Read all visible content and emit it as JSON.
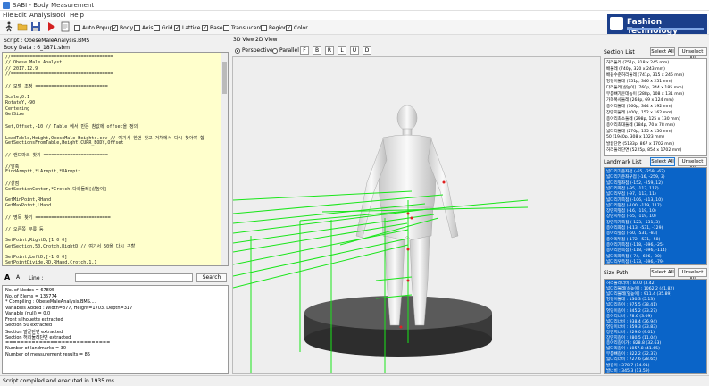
{
  "window": {
    "title": "SABI - Body Measurement"
  },
  "menu": [
    "File",
    "Edit",
    "Analysis",
    "Tool",
    "Help"
  ],
  "toolbar": {
    "buttons": [
      {
        "icon": "walk-icon"
      },
      {
        "icon": "open-folder-icon"
      },
      {
        "icon": "save-icon"
      },
      {
        "icon": "run-icon"
      },
      {
        "icon": "document-icon"
      }
    ],
    "auto_popup": "Auto Popup",
    "checkboxes": [
      {
        "label": "Body",
        "checked": true
      },
      {
        "label": "Axis",
        "checked": false
      },
      {
        "label": "Grid",
        "checked": false
      },
      {
        "label": "Lattice",
        "checked": true
      },
      {
        "label": "Base",
        "checked": true
      },
      {
        "label": "Translucent",
        "checked": false
      },
      {
        "label": "Region",
        "checked": false
      },
      {
        "label": "Color",
        "checked": true
      }
    ]
  },
  "brand": {
    "text": "Fashion Technology"
  },
  "script_info": {
    "script": "Script : ObeseMaleAnalysis.BMS",
    "body_data": "Body Data : 6_1871.sbm"
  },
  "script_lines": [
    "//======================================",
    "//          Obese Male Analyst",
    "//            2017.12.9",
    "//======================================",
    "",
    "// 모델 조정 ===========================",
    "",
    "Scale,0.1",
    "RotateY,-90",
    "Centering",
    "GetSize",
    "",
    "Set,Offset,-10        // Table 에서 만든 참값에 offset을 정의",
    "",
    "LoadTable,Height,ObeseMale_Heights.csv     // 여기서 한번 찾고 거쳐에서 다시 찾아야 함",
    "GetSectionsFromTable,Height,CURR_BODY,Offset",
    "",
    "// 랜드마크 찾기 ========================",
    "",
    "//앞축",
    "FindArmpit,*LArmpit,*RArmpit",
    "",
    "//샅점",
    "GetSectionCenter,*Crotch,다리둘레[샅높이]",
    "",
    "GetMinPoint,RHand",
    "GetMaxPoint,LHand",
    "",
    "// 명목 찾기 ============================",
    "",
    "// 오른쪽 무릎 등",
    "",
    "SetPoint,RightD,[1 0 0]",
    "GetSection,50,Crotch,RightD // 여기서 50을 다시 구할",
    "",
    "SetPoint,LeftD,[-1 0 0]",
    "SetPointDivide,RD,RHand,Crotch,1,1"
  ],
  "find": {
    "aa": "A",
    "aa2": "A",
    "line_label": "Line :",
    "search": "Search"
  },
  "console": [
    "No. of Nodes = 67895",
    "No. of Elems = 135774",
    "* Compiling : ObeseMaleAnalysis.BMS....",
    "Variables Added : Width=877, Height=1703, Depth=317",
    "Variable (null) = 0.0",
    "Front silhouette extracted",
    "Section 50 extracted",
    "Section 발끝단면 extracted",
    "Section 허리둘레단면 extracted",
    "============================",
    "Number of landmarks = 30",
    "Number of measurement results = 85"
  ],
  "status": "Script compiled and executed in 1935 ms",
  "view": {
    "tabs": [
      "3D View",
      "2D View"
    ],
    "perspective": "Perspective",
    "parallel": "Parallel",
    "buttons": [
      "F",
      "B",
      "R",
      "L",
      "U",
      "D"
    ]
  },
  "section_list": {
    "title": "Section List",
    "select_all": "Select All",
    "unselect_all": "Unselect All",
    "items": [
      "허리둘레 (751p, 318 x 245 mm)",
      "배둘레 (740p, 320 x 243 mm)",
      "배꼽수준허리둘레 (741p, 315 x 246 mm)",
      "엉덩이둘레 (751p, 346 x 251 mm)",
      "다리둘레[샅높이] (760p, 344 x 185 mm)",
      "무릎뼈가운데높이 (288p, 108 x 131 mm)",
      "가쪽복사둘레 (268p, 69 x 124 mm)",
      "종아리둘레 (760p, 344 x 192 mm)",
      "장딴지둘레 (400p, 152 x 162 mm)",
      "종아리최소둘레 (298p, 125 x 130 mm)",
      "종아리최대둘레 (184p, 70 x 78 mm)",
      "넓다리둘레 (270p, 135 x 150 mm)",
      "50 (1940p, 308 x 1023 mm)",
      "발끝단면 (5183p, 867 x 1702 mm)",
      "허리둘레단면 (5225p, 854 x 1702 mm)"
    ]
  },
  "landmark_list": {
    "title": "Landmark List",
    "select_all": "Select All",
    "unselect_all": "Unselect All",
    "items": [
      "넓다리기준좌점 (-65, -259, -62)",
      "넓다리기준좌우점 (-16, -259, 3)",
      "넓다리앞좌점 (-152, -259, 12)",
      "넓다리좌점 (-95, -113, 117)",
      "넓다리우점 (-97, -113, 11)",
      "넓다리가쪽점 (-106, -113, 10)",
      "넓다리앞점 (-100, -119, 117)",
      "장딴지앞점 (-16, -119, 10)",
      "장딴지뒤점 (-65, -119, 10)",
      "장딴지가쪽점 (-123, -531, 3)",
      "종아리좌점 (-113, -531, -129)",
      "종아리앞점 (-60, -531, -83)",
      "종아리뒤점 (-172, -531, -58)",
      "종아리가쪽점 (-118, -696, -25)",
      "종아리안쪽점 (-118, -696, -114)",
      "넓다리좌측점 (-74, -696, -80)",
      "넓다리우측점 (-173, -696, -79)"
    ]
  },
  "size_path": {
    "title": "Size Path",
    "select_all": "Select All",
    "unselect_all": "Unselect All",
    "items": [
      "허리둘레너비 : 87.0 (3.42)",
      "넓다리둘레[샅높이] : 1062.2 (41.82)",
      "넓다리둘레[앞높이] : 911.4 (35.89)",
      "엉덩이둘레 : 130.3 (5.13)",
      "넓다리길이 : 975.5 (38.41)",
      "엉덩이길이 : 845.2 (33.27)",
      "종아리너비 : 78.6 (3.09)",
      "넓다리너비 : 938.4 (36.94)",
      "엉덩이너비 : 859.3 (33.83)",
      "장딴지너비 : 229.0 (9.01)",
      "장딴지길이 : 280.5 (11.04)",
      "종아리길이가 : 828.8 (32.63)",
      "넓다리길이 : 1057.8 (41.65)",
      "무릎뼈길이 : 822.2 (32.37)",
      "넓다리너비 : 727.6 (28.65)",
      "발길이 : 378.7 (14.91)",
      "발너비 : 345.3 (13.59)"
    ]
  }
}
